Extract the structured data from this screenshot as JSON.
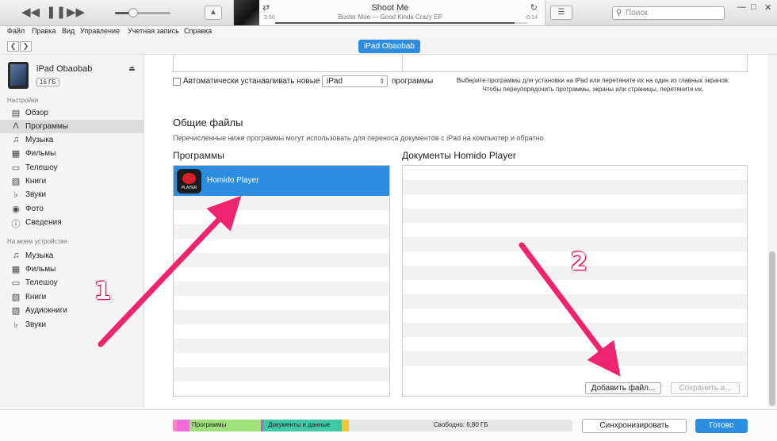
{
  "player": {
    "track_title": "Shoot Me",
    "track_info": "Buster Moe — Good Kinda Crazy EP",
    "elapsed": "3:50",
    "remaining": "-0:14",
    "progress_fraction": 0.95,
    "volume_fraction": 0.35
  },
  "search": {
    "placeholder": "Поиск"
  },
  "menu": [
    "Файл",
    "Правка",
    "Вид",
    "Управление",
    "Учетная запись",
    "Справка"
  ],
  "nav": {
    "device_button": "iPad Obaobab"
  },
  "device": {
    "name": "iPad Obaobab",
    "capacity": "16 ГБ"
  },
  "sidebar": {
    "settings_header": "Настройки",
    "settings_items": [
      {
        "label": "Обзор",
        "icon": "summary-icon"
      },
      {
        "label": "Программы",
        "icon": "apps-icon",
        "active": true
      },
      {
        "label": "Музыка",
        "icon": "music-icon"
      },
      {
        "label": "Фильмы",
        "icon": "film-icon"
      },
      {
        "label": "Телешоу",
        "icon": "tv-icon"
      },
      {
        "label": "Книги",
        "icon": "book-icon"
      },
      {
        "label": "Звуки",
        "icon": "bell-icon"
      },
      {
        "label": "Фото",
        "icon": "camera-icon"
      },
      {
        "label": "Сведения",
        "icon": "info-icon"
      }
    ],
    "device_header": "На моем устройстве",
    "device_items": [
      {
        "label": "Музыка",
        "icon": "music-icon"
      },
      {
        "label": "Фильмы",
        "icon": "film-icon"
      },
      {
        "label": "Телешоу",
        "icon": "tv-icon"
      },
      {
        "label": "Книги",
        "icon": "book-icon"
      },
      {
        "label": "Аудиокниги",
        "icon": "audiobook-icon"
      },
      {
        "label": "Звуки",
        "icon": "bell-icon"
      }
    ]
  },
  "main": {
    "auto_install_label": "Автоматически устанавливать новые",
    "device_select": "iPad",
    "programs_word": "программы",
    "hint_line1": "Выберите программы для установки на iPad или перетяните их на один из главных экранов.",
    "hint_line2": "Чтобы переупорядочить программы, экраны или страницы, перетяните их.",
    "shared_title": "Общие файлы",
    "shared_desc": "Перечисленные ниже программы могут использовать для переноса документов с iPad на компьютер и обратно.",
    "apps_column_title": "Программы",
    "docs_column_title": "Документы Homido Player",
    "app_name": "Homido Player",
    "app_icon_text": "PLAYER",
    "add_file_button": "Добавить файл...",
    "save_to_button": "Сохранить в..."
  },
  "storage": {
    "programs_label": "Программы",
    "docs_label": "Документы и данные",
    "free_label": "Свободно: 6,80 ГБ"
  },
  "footer": {
    "sync_button": "Синхронизировать",
    "done_button": "Готово"
  },
  "annotations": {
    "step1": "1",
    "step2": "2"
  },
  "colors": {
    "accent": "#2d8de0",
    "arrow": "#f0246e"
  }
}
